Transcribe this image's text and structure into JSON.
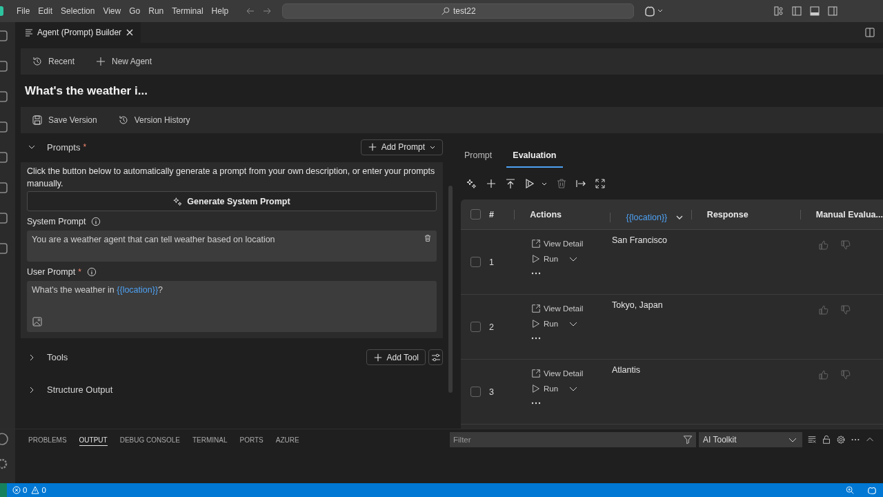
{
  "menu": [
    "File",
    "Edit",
    "Selection",
    "View",
    "Go",
    "Run",
    "Terminal",
    "Help"
  ],
  "command_center": {
    "text": "test22"
  },
  "editor_tab": {
    "title": "Agent (Prompt) Builder"
  },
  "toolbar": [
    "Recent",
    "New Agent"
  ],
  "agent_title": "What's the weather i...",
  "version_bar": [
    "Save Version",
    "Version History"
  ],
  "prompts": {
    "title": "Prompts",
    "required_mark": "*",
    "expanded": true,
    "add_button": "Add Prompt",
    "description": "Click the button below to automatically generate a prompt from your own description, or enter your prompts manually.",
    "generate_button": "Generate System Prompt",
    "system_prompt": {
      "label": "System Prompt",
      "value": [
        {
          "kind": "text",
          "text": "You are a weather agent that can tell weather based on location"
        }
      ]
    },
    "user_prompt": {
      "label": "User Prompt",
      "required_mark": "*",
      "value": [
        {
          "kind": "text",
          "text": "What's the weather in "
        },
        {
          "kind": "variable",
          "text": "{{location}}"
        },
        {
          "kind": "text",
          "text": "?"
        }
      ]
    }
  },
  "sections": [
    {
      "title": "Tools",
      "expanded": false,
      "button": "Add Tool"
    },
    {
      "title": "Structure Output",
      "expanded": false
    }
  ],
  "right_tabs": [
    {
      "label": "Prompt",
      "selected": false
    },
    {
      "label": "Evaluation",
      "selected": true
    }
  ],
  "table": {
    "select_all_checked": false,
    "columns": [
      {
        "label": "#",
        "kind": "text"
      },
      {
        "label": "Actions",
        "kind": "text"
      },
      {
        "label": "{{location}}",
        "kind": "variable"
      },
      {
        "label": "Response",
        "kind": "text"
      },
      {
        "label": "Manual Evalua...",
        "kind": "text"
      }
    ],
    "rows": [
      {
        "number": "1",
        "checked": false,
        "location": "San Francisco",
        "view": "View Detail",
        "run": "Run"
      },
      {
        "number": "2",
        "checked": false,
        "location": "Tokyo, Japan",
        "view": "View Detail",
        "run": "Run"
      },
      {
        "number": "3",
        "checked": false,
        "location": "Atlantis",
        "view": "View Detail",
        "run": "Run"
      }
    ]
  },
  "panel": {
    "tabs": [
      {
        "label": "PROBLEMS",
        "selected": false
      },
      {
        "label": "OUTPUT",
        "selected": true
      },
      {
        "label": "DEBUG CONSOLE",
        "selected": false
      },
      {
        "label": "TERMINAL",
        "selected": false
      },
      {
        "label": "PORTS",
        "selected": false
      },
      {
        "label": "AZURE",
        "selected": false
      }
    ],
    "filter_placeholder": "Filter",
    "channel": "AI Toolkit"
  },
  "status_bar": {
    "errors": "0",
    "warnings": "0"
  }
}
